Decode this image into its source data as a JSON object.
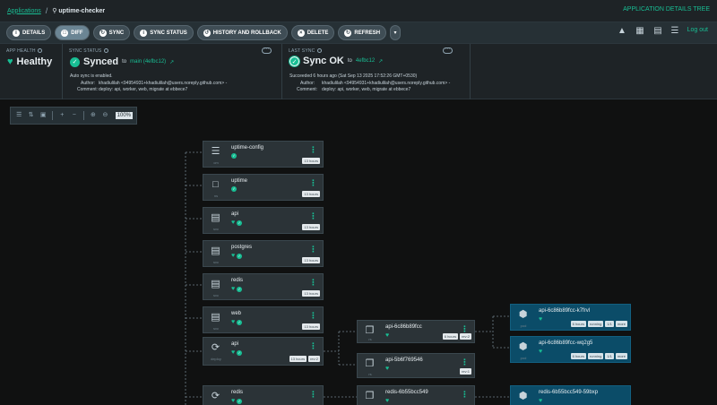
{
  "breadcrumb": {
    "root": "Applications",
    "current": "uptime-checker"
  },
  "header": {
    "view_title": "APPLICATION DETAILS TREE",
    "logout": "Log out"
  },
  "toolbar": {
    "details": "DETAILS",
    "diff": "DIFF",
    "sync": "SYNC",
    "sync_status": "SYNC STATUS",
    "history": "HISTORY AND ROLLBACK",
    "delete": "DELETE",
    "refresh": "REFRESH"
  },
  "app_health": {
    "label": "APP HEALTH",
    "value": "Healthy"
  },
  "sync_status": {
    "label": "SYNC STATUS",
    "value": "Synced",
    "to": "to",
    "revision": "main (4efbc12)",
    "auto_sync": "Auto sync is enabled.",
    "author_label": "Author:",
    "author": "khadiulilah <94954931+khadiulilah@users.noreply.github.com> -",
    "comment_label": "Comment:",
    "comment": "deploy: api, worker, web, migrate at ebbece7"
  },
  "last_sync": {
    "label": "LAST SYNC",
    "value": "Sync OK",
    "to": "to",
    "revision": "4efbc12",
    "succeeded": "Succeeded 6 hours ago (Sat Sep 13 2025 17:52:26 GMT+0530)",
    "author_label": "Author:",
    "author": "khadiulilah <94954931+khadiulilah@users.noreply.github.com> -",
    "comment_label": "Comment:",
    "comment": "deploy: api, worker, web, migrate at ebbece7"
  },
  "zoom": {
    "level": "100%"
  },
  "tree": {
    "children": [
      {
        "name": "uptime-config",
        "kind": "cm",
        "tags": [
          "13 hours"
        ]
      },
      {
        "name": "uptime",
        "kind": "ns",
        "tags": [
          "13 hours"
        ]
      },
      {
        "name": "api",
        "kind": "svc",
        "tags": [
          "13 hours"
        ]
      },
      {
        "name": "postgres",
        "kind": "svc",
        "tags": [
          "13 hours"
        ]
      },
      {
        "name": "redis",
        "kind": "svc",
        "tags": [
          "13 hours"
        ]
      },
      {
        "name": "web",
        "kind": "svc",
        "tags": [
          "13 hours"
        ]
      },
      {
        "name": "api",
        "kind": "deploy",
        "tags": [
          "13 hours",
          "rev:2"
        ]
      },
      {
        "name": "redis",
        "kind": "deploy",
        "tags": []
      }
    ],
    "replicasets": [
      {
        "name": "api-6c86b89fcc",
        "kind": "rs",
        "tags": [
          "6 hours",
          "rev:2"
        ]
      },
      {
        "name": "api-5b6f769546",
        "kind": "rs",
        "tags": [
          "rev:1"
        ]
      },
      {
        "name": "redis-6b55bcc549",
        "kind": "rs",
        "tags": []
      }
    ],
    "pods": [
      {
        "name": "api-6c86b89fcc-k7frvl",
        "kind": "pod",
        "tags": [
          "6 hours",
          "running",
          "1/1",
          "more"
        ]
      },
      {
        "name": "api-6c86b89fcc-wq2g5",
        "kind": "pod",
        "tags": [
          "6 hours",
          "running",
          "1/1",
          "more"
        ]
      },
      {
        "name": "redis-6b55bcc549-59bxp",
        "kind": "pod",
        "tags": []
      }
    ]
  }
}
